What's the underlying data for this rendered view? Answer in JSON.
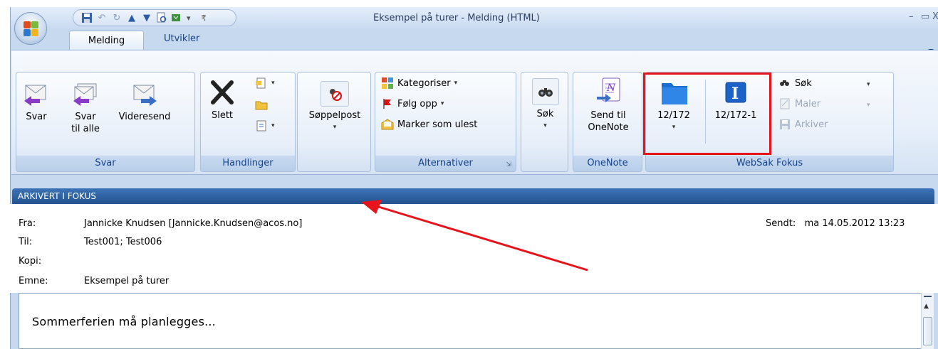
{
  "window": {
    "title": "Eksempel på turer - Melding (HTML)",
    "minimize": "–",
    "maximize": "▭",
    "close": "X"
  },
  "tabs": [
    {
      "label": "Melding",
      "active": true
    },
    {
      "label": "Utvikler",
      "active": false
    }
  ],
  "help_label": "?",
  "groups": {
    "svar": {
      "title": "Svar",
      "reply": "Svar",
      "reply_all_1": "Svar",
      "reply_all_2": "til alle",
      "forward": "Videresend"
    },
    "handlinger": {
      "title": "Handlinger",
      "delete": "Slett"
    },
    "junk": {
      "label": "Søppelpost"
    },
    "alternativer": {
      "title": "Alternativer",
      "categorize": "Kategoriser",
      "follow_up": "Følg opp",
      "mark_unread": "Marker som ulest"
    },
    "search": {
      "label": "Søk"
    },
    "onenote": {
      "title": "OneNote",
      "send_1": "Send til",
      "send_2": "OneNote"
    },
    "websak": {
      "title": "WebSak Fokus",
      "case": "12/172",
      "doc": "12/172-1",
      "search": "Søk",
      "templates": "Maler",
      "archive": "Arkiver"
    }
  },
  "infobar": "ARKIVERT I FOKUS",
  "message": {
    "from_label": "Fra:",
    "from_value": "Jannicke Knudsen [Jannicke.Knudsen@acos.no]",
    "to_label": "Til:",
    "to_value": "Test001; Test006",
    "cc_label": "Kopi:",
    "subject_label": "Emne:",
    "subject_value": "Eksempel på turer",
    "sent_label": "Sendt:",
    "sent_value": "ma 14.05.2012 13:23",
    "body": "Sommerferien må planlegges..."
  },
  "colors": {
    "highlight": "#e8141c",
    "infobar": "#2d5f9e"
  }
}
